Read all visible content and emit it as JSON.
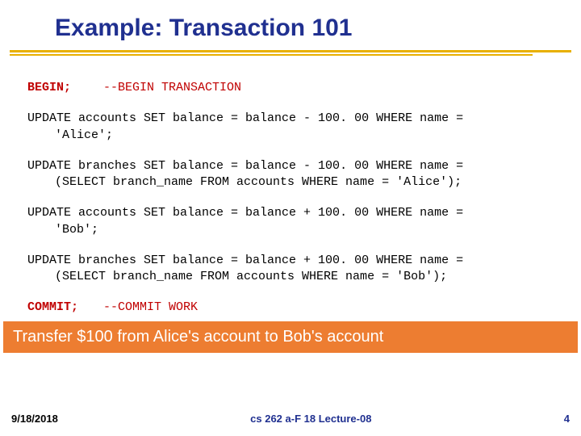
{
  "title": "Example: Transaction 101",
  "code": {
    "begin_kw": "BEGIN;",
    "begin_comment": "--BEGIN TRANSACTION",
    "stmt1_a": "UPDATE accounts SET balance = balance - 100. 00 WHERE name =",
    "stmt1_b": "'Alice';",
    "stmt2_a": "UPDATE branches SET balance = balance - 100. 00 WHERE name =",
    "stmt2_b": "(SELECT branch_name FROM accounts WHERE name = 'Alice');",
    "stmt3_a": "UPDATE accounts SET balance = balance + 100. 00 WHERE name =",
    "stmt3_b": "'Bob';",
    "stmt4_a": "UPDATE branches SET balance = balance + 100. 00 WHERE name =",
    "stmt4_b": "(SELECT branch_name FROM accounts WHERE name = 'Bob');",
    "commit_kw": "COMMIT;",
    "commit_comment": "--COMMIT WORK"
  },
  "caption": "Transfer $100 from Alice's account to Bob's account",
  "footer": {
    "date": "9/18/2018",
    "center": "cs 262 a-F 18 Lecture-08",
    "page": "4"
  }
}
